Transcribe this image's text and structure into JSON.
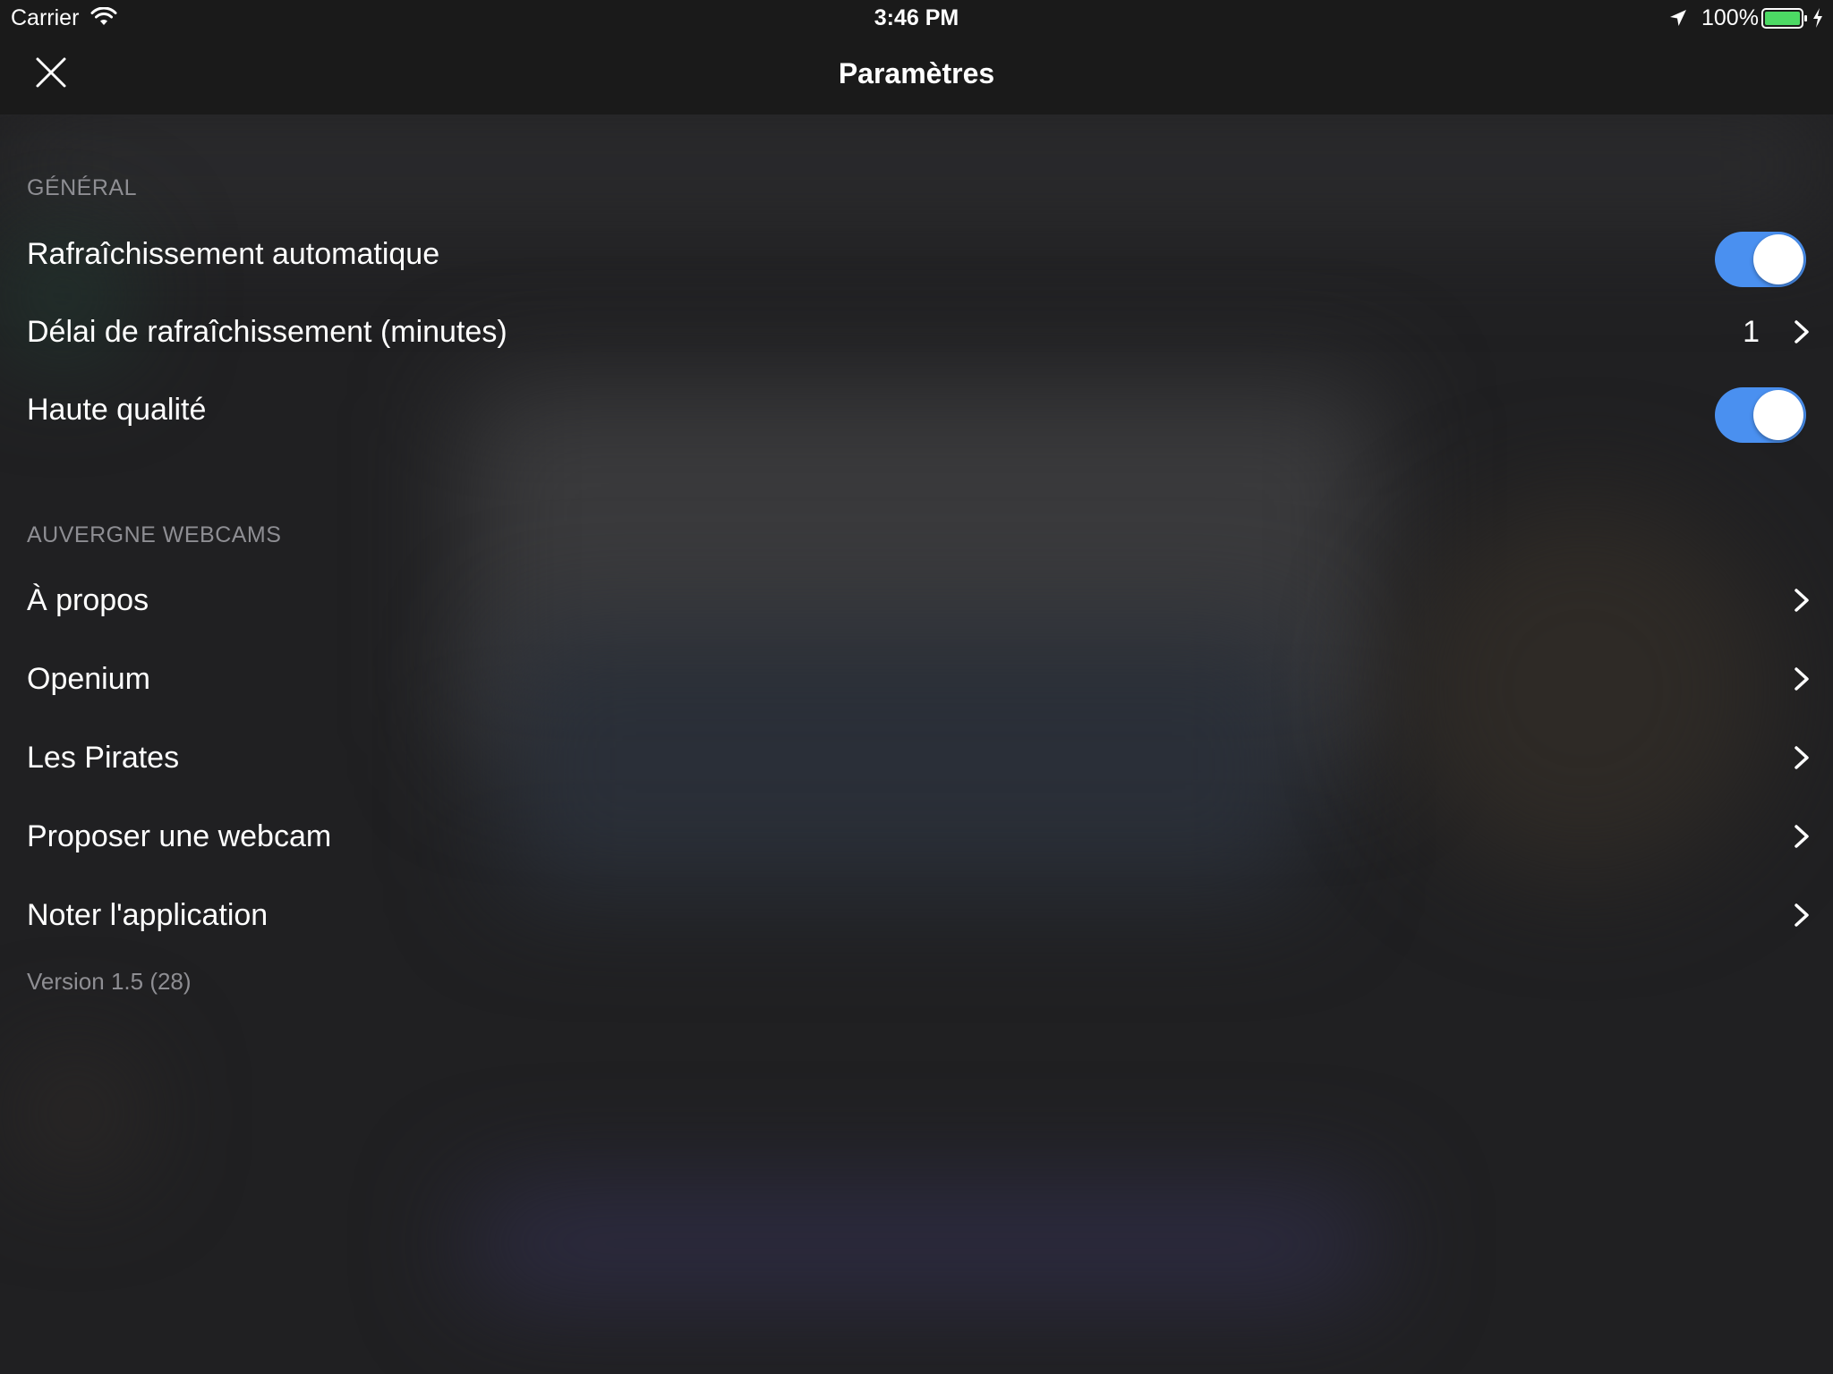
{
  "status_bar": {
    "carrier": "Carrier",
    "time": "3:46 PM",
    "battery": "100%"
  },
  "nav": {
    "title": "Paramètres"
  },
  "sections": {
    "general": {
      "header": "GÉNÉRAL",
      "auto_refresh": {
        "label": "Rafraîchissement automatique",
        "enabled": true
      },
      "refresh_delay": {
        "label": "Délai de rafraîchissement (minutes)",
        "value": "1"
      },
      "high_quality": {
        "label": "Haute qualité",
        "enabled": true
      }
    },
    "about": {
      "header": "AUVERGNE WEBCAMS",
      "items": [
        {
          "label": "À propos"
        },
        {
          "label": "Openium"
        },
        {
          "label": "Les Pirates"
        },
        {
          "label": "Proposer une webcam"
        },
        {
          "label": "Noter l'application"
        }
      ]
    }
  },
  "footer": {
    "version": "Version 1.5 (28)"
  },
  "colors": {
    "toggle_on": "#4a90f0",
    "battery_fill": "#4cd964",
    "background": "#202022",
    "secondary_text": "#8e8e93"
  },
  "icons": {
    "close": "close-icon",
    "chevron": "chevron-right-icon",
    "wifi": "wifi-icon",
    "location": "location-arrow-icon",
    "battery": "battery-icon",
    "charging": "charging-bolt-icon"
  }
}
